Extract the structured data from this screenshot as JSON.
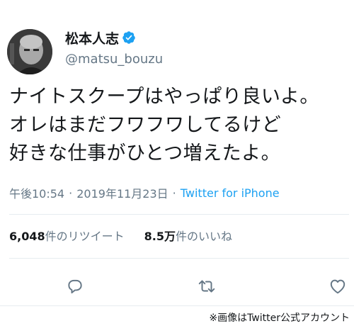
{
  "profile": {
    "display_name": "松本人志",
    "handle": "@matsu_bouzu",
    "avatar_icon": "user-avatar",
    "verified_icon": "verified-badge-icon"
  },
  "tweet": {
    "lines": [
      "ナイトスクープはやっぱり良いよ。",
      "オレはまだフワフワしてるけど",
      "好きな仕事がひとつ増えたよ。"
    ]
  },
  "meta": {
    "time": "午後10:54",
    "separator": "·",
    "date": "2019年11月23日",
    "source": "Twitter for iPhone"
  },
  "stats": {
    "retweet_count": "6,048",
    "retweet_label": "件のリツイート",
    "like_count": "8.5万",
    "like_label": "件のいいね"
  },
  "actions": {
    "reply_icon": "reply-icon",
    "retweet_icon": "retweet-icon",
    "like_icon": "heart-icon"
  },
  "colors": {
    "accent": "#1da1f2",
    "text": "#14171a",
    "muted": "#657786"
  },
  "caption": "※画像はTwitter公式アカウント"
}
